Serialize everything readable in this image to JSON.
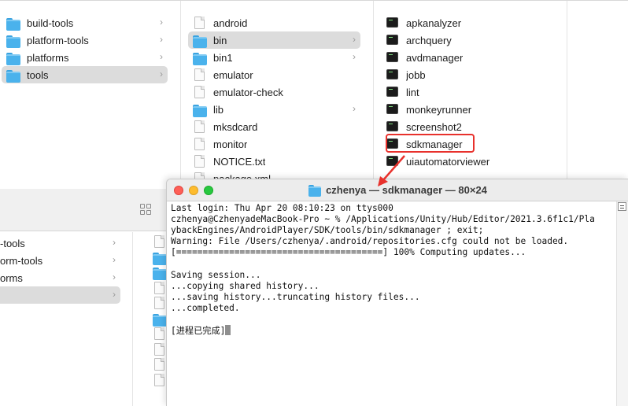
{
  "finder_back": {
    "column1": [
      {
        "label": "build-tools",
        "icon": "folder",
        "chevron": "›",
        "selected": false
      },
      {
        "label": "platform-tools",
        "icon": "folder",
        "chevron": "›",
        "selected": false
      },
      {
        "label": "platforms",
        "icon": "folder",
        "chevron": "›",
        "selected": false
      },
      {
        "label": "tools",
        "icon": "folder",
        "chevron": "›",
        "selected": true
      }
    ],
    "column2": [
      {
        "label": "android",
        "icon": "document",
        "chevron": "",
        "selected": false
      },
      {
        "label": "bin",
        "icon": "folder",
        "chevron": "›",
        "selected": true
      },
      {
        "label": "bin1",
        "icon": "folder",
        "chevron": "›",
        "selected": false
      },
      {
        "label": "emulator",
        "icon": "document",
        "chevron": "",
        "selected": false
      },
      {
        "label": "emulator-check",
        "icon": "document",
        "chevron": "",
        "selected": false
      },
      {
        "label": "lib",
        "icon": "folder",
        "chevron": "›",
        "selected": false
      },
      {
        "label": "mksdcard",
        "icon": "document",
        "chevron": "",
        "selected": false
      },
      {
        "label": "monitor",
        "icon": "document",
        "chevron": "",
        "selected": false
      },
      {
        "label": "NOTICE.txt",
        "icon": "document",
        "chevron": "",
        "selected": false
      },
      {
        "label": "package.xml",
        "icon": "document",
        "chevron": "",
        "selected": false
      }
    ],
    "column3": [
      {
        "label": "apkanalyzer",
        "icon": "executable",
        "selected": false
      },
      {
        "label": "archquery",
        "icon": "executable",
        "selected": false
      },
      {
        "label": "avdmanager",
        "icon": "executable",
        "selected": false
      },
      {
        "label": "jobb",
        "icon": "executable",
        "selected": false
      },
      {
        "label": "lint",
        "icon": "executable",
        "selected": false
      },
      {
        "label": "monkeyrunner",
        "icon": "executable",
        "selected": false
      },
      {
        "label": "screenshot2",
        "icon": "executable",
        "selected": false
      },
      {
        "label": "sdkmanager",
        "icon": "executable",
        "selected": false,
        "highlighted": true
      },
      {
        "label": "uiautomatorviewer",
        "icon": "executable",
        "selected": false
      }
    ]
  },
  "finder_front": {
    "column1": [
      {
        "label": "-tools",
        "chevron": "›",
        "selected": false
      },
      {
        "label": "orm-tools",
        "chevron": "›",
        "selected": false
      },
      {
        "label": "orms",
        "chevron": "›",
        "selected": false
      },
      {
        "label": "",
        "chevron": "›",
        "selected": true
      }
    ]
  },
  "terminal": {
    "title": "czhenya — sdkmanager — 80×24",
    "lines": [
      "Last login: Thu Apr 20 08:10:23 on ttys000",
      "czhenya@CzhenyadeMacBook-Pro ~ % /Applications/Unity/Hub/Editor/2021.3.6f1c1/Pla",
      "ybackEngines/AndroidPlayer/SDK/tools/bin/sdkmanager ; exit;",
      "Warning: File /Users/czhenya/.android/repositories.cfg could not be loaded.",
      "[=======================================] 100% Computing updates...",
      "",
      "Saving session...",
      "...copying shared history...",
      "...saving history...truncating history files...",
      "...completed.",
      "",
      "[进程已完成]"
    ]
  },
  "colors": {
    "highlight_box": "#e8312c",
    "arrow": "#e8312c",
    "selection": "#dcdcdc",
    "folder": "#4ab2ec"
  }
}
